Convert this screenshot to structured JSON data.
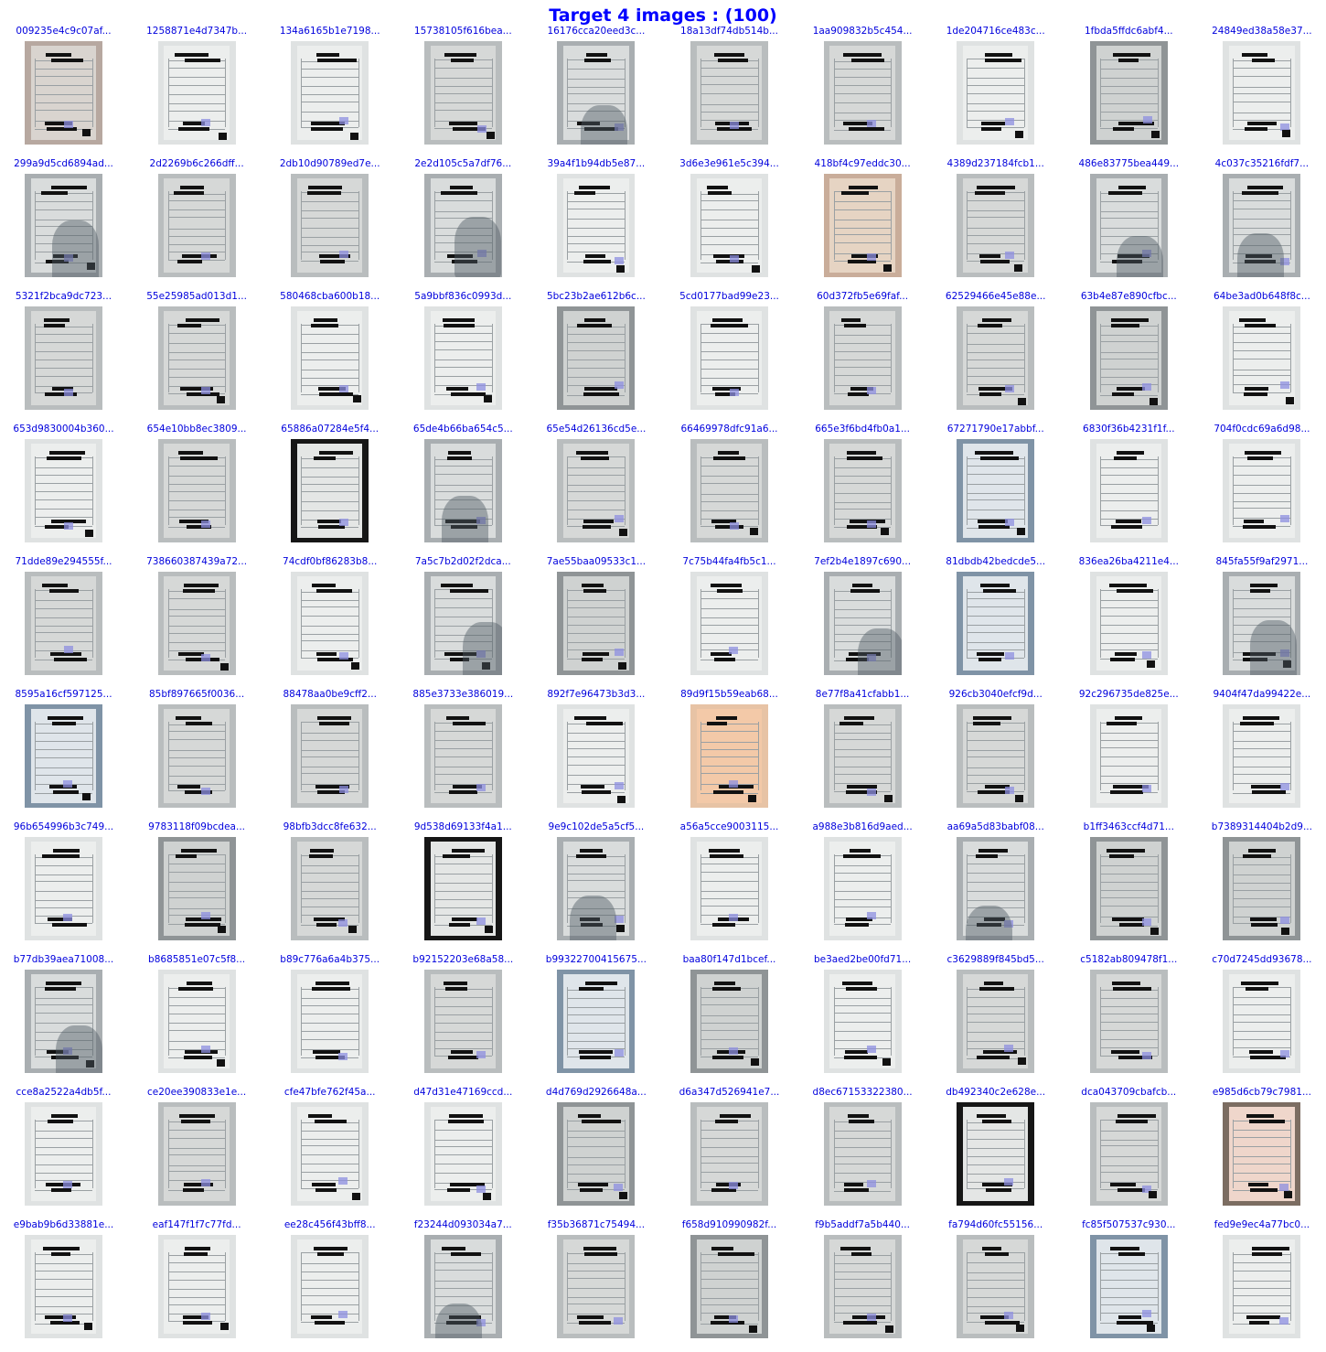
{
  "title": "Target 4 images : (100)",
  "accent_color": "#0000ff",
  "caption_color": "#0000dd",
  "images": [
    {
      "label": "009235e4c9c07af...",
      "tone": "warm"
    },
    {
      "label": "1258871e4d7347b...",
      "tone": "light"
    },
    {
      "label": "134a6165b1e7198...",
      "tone": "light"
    },
    {
      "label": "15738105f616bea...",
      "tone": "grey"
    },
    {
      "label": "16176cca20eed3c...",
      "tone": "shadow"
    },
    {
      "label": "18a13df74db514b...",
      "tone": "grey"
    },
    {
      "label": "1aa909832b5c454...",
      "tone": "grey"
    },
    {
      "label": "1de204716ce483c...",
      "tone": "light"
    },
    {
      "label": "1fbda5ffdc6abf4...",
      "tone": "dark"
    },
    {
      "label": "24849ed38a58e37...",
      "tone": "light"
    },
    {
      "label": "299a9d5cd6894ad...",
      "tone": "shadow"
    },
    {
      "label": "2d2269b6c266dff...",
      "tone": "grey"
    },
    {
      "label": "2db10d90789ed7e...",
      "tone": "grey"
    },
    {
      "label": "2e2d105c5a7df76...",
      "tone": "shadow"
    },
    {
      "label": "39a4f1b94db5e87...",
      "tone": "light"
    },
    {
      "label": "3d6e3e961e5c394...",
      "tone": "light"
    },
    {
      "label": "418bf4c97eddc30...",
      "tone": "beige"
    },
    {
      "label": "4389d237184fcb1...",
      "tone": "grey"
    },
    {
      "label": "486e83775bea449...",
      "tone": "shadow"
    },
    {
      "label": "4c037c35216fdf7...",
      "tone": "shadow"
    },
    {
      "label": "5321f2bca9dc723...",
      "tone": "grey"
    },
    {
      "label": "55e25985ad013d1...",
      "tone": "grey"
    },
    {
      "label": "580468cba600b18...",
      "tone": "light"
    },
    {
      "label": "5a9bbf836c0993d...",
      "tone": "light"
    },
    {
      "label": "5bc23b2ae612b6c...",
      "tone": "dark"
    },
    {
      "label": "5cd0177bad99e23...",
      "tone": "light"
    },
    {
      "label": "60d372fb5e69faf...",
      "tone": "grey"
    },
    {
      "label": "62529466e45e88e...",
      "tone": "grey"
    },
    {
      "label": "63b4e87e890cfbc...",
      "tone": "dark"
    },
    {
      "label": "64be3ad0b648f8c...",
      "tone": "light"
    },
    {
      "label": "653d9830004b360...",
      "tone": "light"
    },
    {
      "label": "654e10bb8ec3809...",
      "tone": "grey"
    },
    {
      "label": "65886a07284e5f4...",
      "tone": "black"
    },
    {
      "label": "65de4b66ba654c5...",
      "tone": "shadow"
    },
    {
      "label": "65e54d26136cd5e...",
      "tone": "grey"
    },
    {
      "label": "66469978dfc91a6...",
      "tone": "grey"
    },
    {
      "label": "665e3f6bd4fb0a1...",
      "tone": "grey"
    },
    {
      "label": "67271790e17abbf...",
      "tone": "blue"
    },
    {
      "label": "6830f36b4231f1f...",
      "tone": "light"
    },
    {
      "label": "704f0cdc69a6d98...",
      "tone": "light"
    },
    {
      "label": "71dde89e294555f...",
      "tone": "grey"
    },
    {
      "label": "738660387439a72...",
      "tone": "grey"
    },
    {
      "label": "74cdf0bf86283b8...",
      "tone": "light"
    },
    {
      "label": "7a5c7b2d02f2dca...",
      "tone": "shadow"
    },
    {
      "label": "7ae55baa09533c1...",
      "tone": "dark"
    },
    {
      "label": "7c75b44fa4fb5c1...",
      "tone": "light"
    },
    {
      "label": "7ef2b4e1897c690...",
      "tone": "shadow"
    },
    {
      "label": "81dbdb42bedcde5...",
      "tone": "blue"
    },
    {
      "label": "836ea26ba4211e4...",
      "tone": "light"
    },
    {
      "label": "845fa55f9af2971...",
      "tone": "shadow"
    },
    {
      "label": "8595a16cf597125...",
      "tone": "blue"
    },
    {
      "label": "85bf897665f0036...",
      "tone": "grey"
    },
    {
      "label": "88478aa0be9cff2...",
      "tone": "grey"
    },
    {
      "label": "885e3733e386019...",
      "tone": "grey"
    },
    {
      "label": "892f7e96473b3d3...",
      "tone": "light"
    },
    {
      "label": "89d9f15b59eab68...",
      "tone": "orange"
    },
    {
      "label": "8e77f8a41cfabb1...",
      "tone": "grey"
    },
    {
      "label": "926cb3040efcf9d...",
      "tone": "grey"
    },
    {
      "label": "92c296735de825e...",
      "tone": "light"
    },
    {
      "label": "9404f47da99422e...",
      "tone": "light"
    },
    {
      "label": "96b654996b3c749...",
      "tone": "light"
    },
    {
      "label": "9783118f09bcdea...",
      "tone": "dark"
    },
    {
      "label": "98bfb3dcc8fe632...",
      "tone": "grey"
    },
    {
      "label": "9d538d69133f4a1...",
      "tone": "black"
    },
    {
      "label": "9e9c102de5a5cf5...",
      "tone": "shadow"
    },
    {
      "label": "a56a5cce9003115...",
      "tone": "light"
    },
    {
      "label": "a988e3b816d9aed...",
      "tone": "light"
    },
    {
      "label": "aa69a5d83babf08...",
      "tone": "shadow"
    },
    {
      "label": "b1ff3463ccf4d71...",
      "tone": "dark"
    },
    {
      "label": "b7389314404b2d9...",
      "tone": "dark"
    },
    {
      "label": "b77db39aea71008...",
      "tone": "shadow"
    },
    {
      "label": "b8685851e07c5f8...",
      "tone": "light"
    },
    {
      "label": "b89c776a6a4b375...",
      "tone": "light"
    },
    {
      "label": "b92152203e68a58...",
      "tone": "grey"
    },
    {
      "label": "b99322700415675...",
      "tone": "blue"
    },
    {
      "label": "baa80f147d1bcef...",
      "tone": "dark"
    },
    {
      "label": "be3aed2be00fd71...",
      "tone": "light"
    },
    {
      "label": "c3629889f845bd5...",
      "tone": "grey"
    },
    {
      "label": "c5182ab809478f1...",
      "tone": "grey"
    },
    {
      "label": "c70d7245dd93678...",
      "tone": "light"
    },
    {
      "label": "cce8a2522a4db5f...",
      "tone": "light"
    },
    {
      "label": "ce20ee390833e1e...",
      "tone": "grey"
    },
    {
      "label": "cfe47bfe762f45a...",
      "tone": "light"
    },
    {
      "label": "d47d31e47169ccd...",
      "tone": "light"
    },
    {
      "label": "d4d769d2926648a...",
      "tone": "dark"
    },
    {
      "label": "d6a347d526941e7...",
      "tone": "grey"
    },
    {
      "label": "d8ec67153322380...",
      "tone": "grey"
    },
    {
      "label": "db492340c2e628e...",
      "tone": "black"
    },
    {
      "label": "dca043709cbafcb...",
      "tone": "grey"
    },
    {
      "label": "e985d6cb79c7981...",
      "tone": "pink"
    },
    {
      "label": "e9bab9b6d33881e...",
      "tone": "light"
    },
    {
      "label": "eaf147f1f7c77fd...",
      "tone": "light"
    },
    {
      "label": "ee28c456f43bff8...",
      "tone": "light"
    },
    {
      "label": "f23244d093034a7...",
      "tone": "shadow"
    },
    {
      "label": "f35b36871c75494...",
      "tone": "grey"
    },
    {
      "label": "f658d910990982f...",
      "tone": "dark"
    },
    {
      "label": "f9b5addf7a5b440...",
      "tone": "grey"
    },
    {
      "label": "fa794d60fc55156...",
      "tone": "grey"
    },
    {
      "label": "fc85f507537c930...",
      "tone": "blue"
    },
    {
      "label": "fed9e9ec4a77bc0...",
      "tone": "light"
    }
  ]
}
